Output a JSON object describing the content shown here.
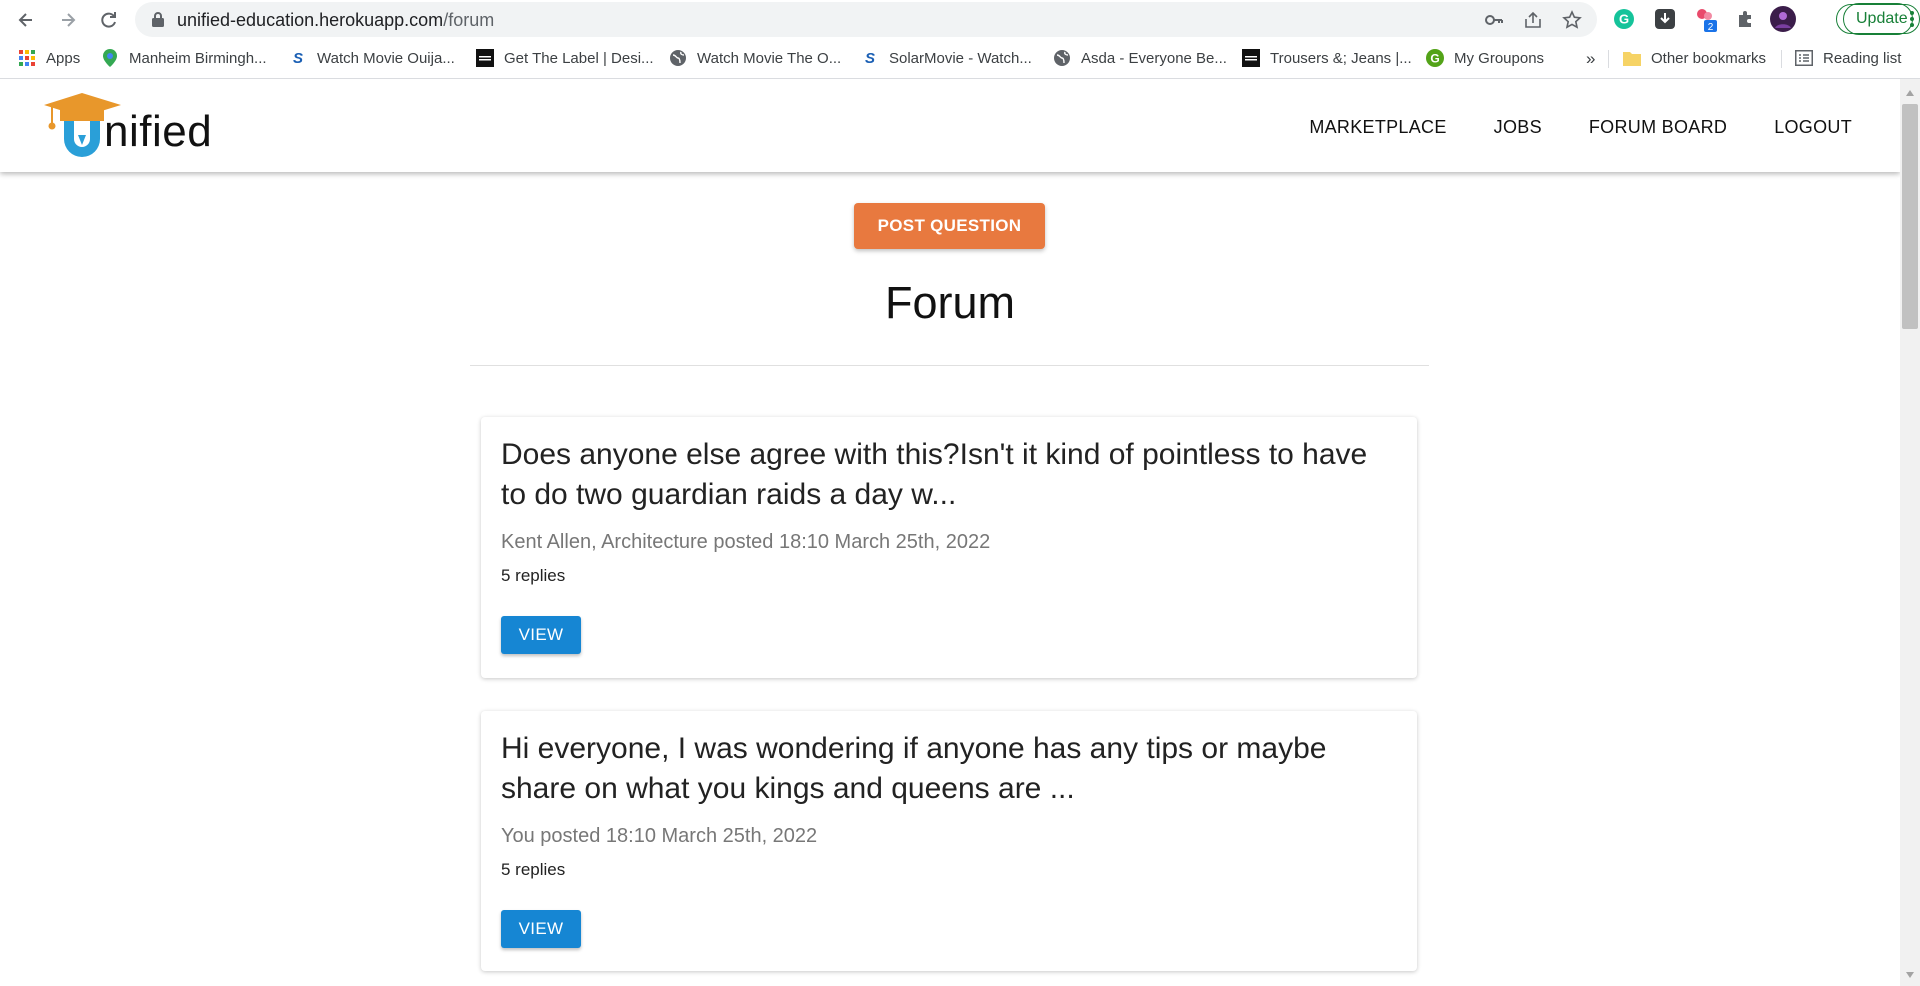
{
  "browser": {
    "url_host": "unified-education.herokuapp.com",
    "url_path": "/forum",
    "update_label": "Update",
    "extension_badge": "2",
    "bookmarks": [
      {
        "label": "Apps",
        "icon": "apps-grid-icon"
      },
      {
        "label": "Manheim Birmingh...",
        "icon": "maps-pin-icon"
      },
      {
        "label": "Watch Movie Ouija...",
        "icon": "solarmovie-icon"
      },
      {
        "label": "Get The Label | Desi...",
        "icon": "gtl-icon"
      },
      {
        "label": "Watch Movie The O...",
        "icon": "globe-icon"
      },
      {
        "label": "SolarMovie - Watch...",
        "icon": "solarmovie-icon"
      },
      {
        "label": "Asda - Everyone Be...",
        "icon": "globe-icon"
      },
      {
        "label": "Trousers &; Jeans |...",
        "icon": "gtl-icon"
      },
      {
        "label": "My Groupons",
        "icon": "groupon-icon"
      }
    ],
    "overflow_label": "»",
    "other_bookmarks": "Other bookmarks",
    "reading_list": "Reading list"
  },
  "site": {
    "logo_text": "nified",
    "logo_letter": "U",
    "nav": [
      "MARKETPLACE",
      "JOBS",
      "FORUM BOARD",
      "LOGOUT"
    ],
    "post_button": "POST QUESTION",
    "page_title": "Forum"
  },
  "posts": [
    {
      "title": "Does anyone else agree with this?Isn't it kind of pointless to have to do two guardian raids a day w...",
      "meta": "Kent Allen, Architecture posted 18:10 March 25th, 2022",
      "replies": "5 replies",
      "view_label": "VIEW"
    },
    {
      "title": "Hi everyone, I was wondering if anyone has any tips or maybe share on what you kings and queens are ...",
      "meta": "You posted 18:10 March 25th, 2022",
      "replies": "5 replies",
      "view_label": "VIEW"
    }
  ],
  "colors": {
    "post_button": "#e8793f",
    "view_button": "#1686d3",
    "logo_u": "#2a9fd8",
    "logo_cap": "#e8972b",
    "update_green": "#188038"
  }
}
